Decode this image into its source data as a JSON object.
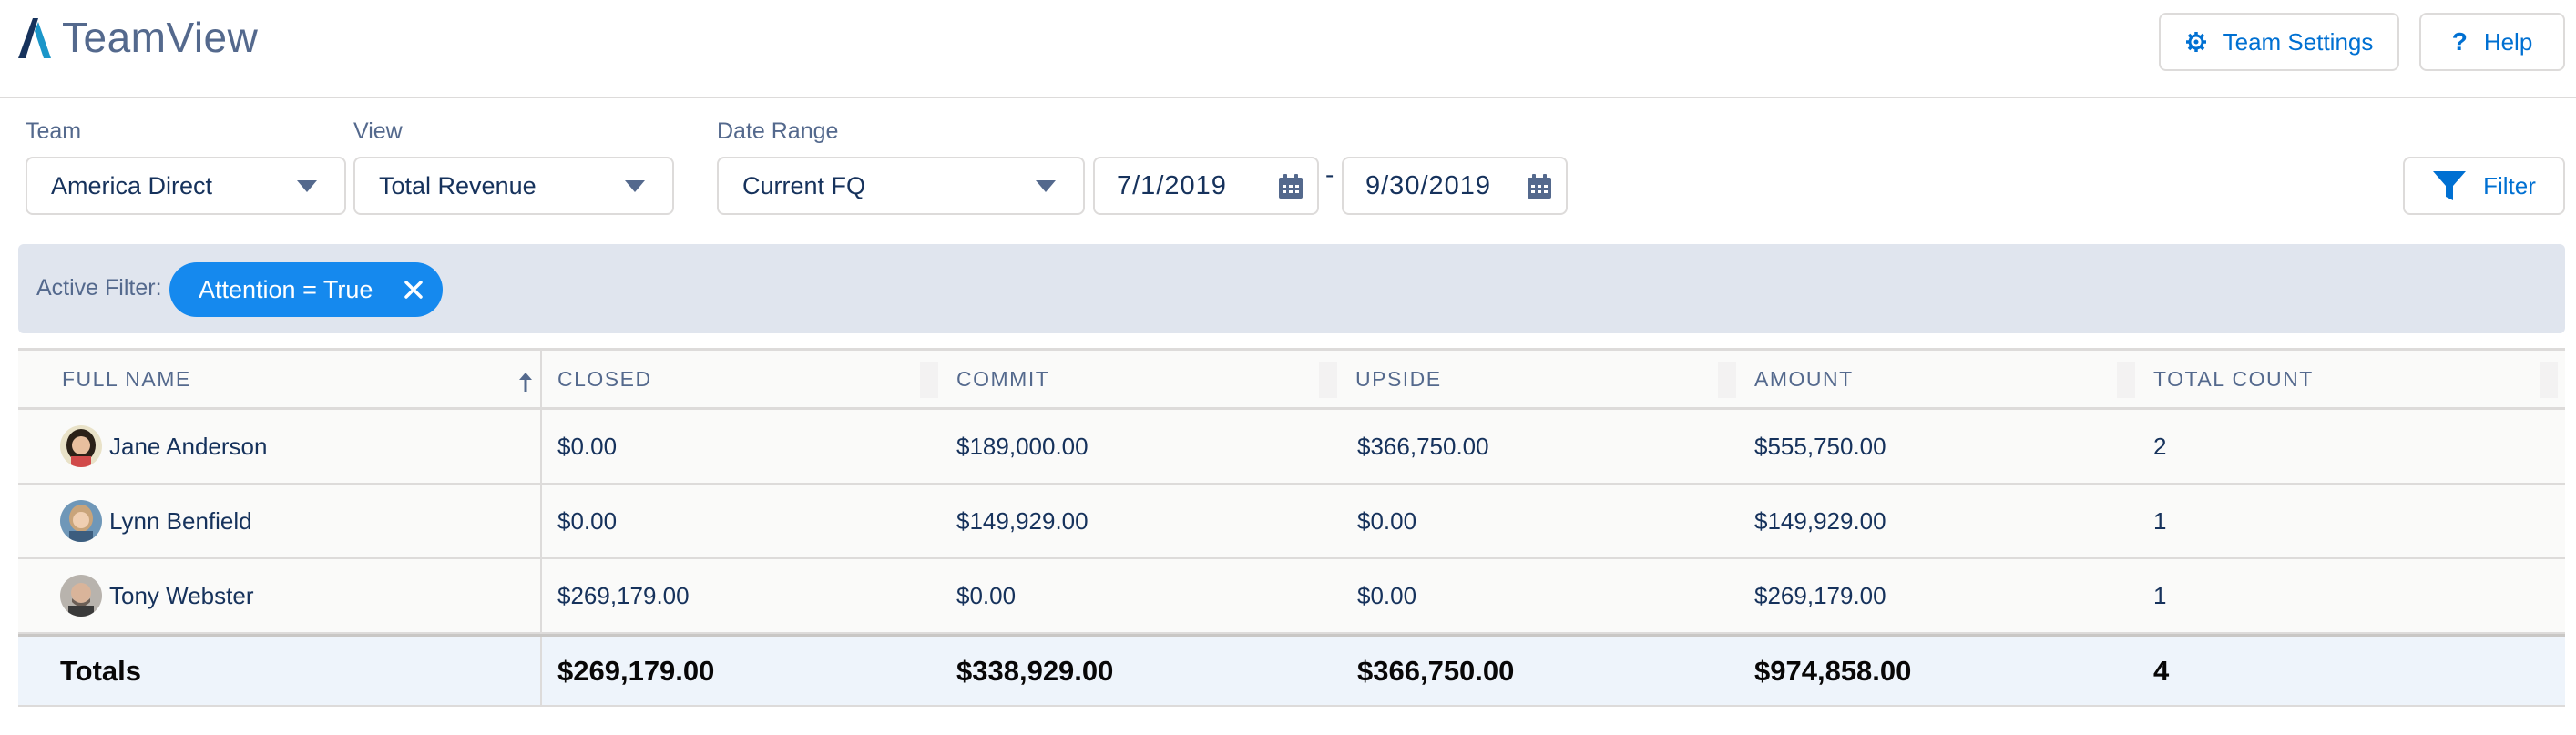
{
  "app": {
    "title": "TeamView"
  },
  "header": {
    "settings_label": "Team Settings",
    "help_label": "Help"
  },
  "filters": {
    "team": {
      "label": "Team",
      "value": "America Direct"
    },
    "view": {
      "label": "View",
      "value": "Total Revenue"
    },
    "date_range": {
      "label": "Date Range",
      "value": "Current FQ",
      "start": "7/1/2019",
      "end": "9/30/2019",
      "separator": "-"
    },
    "filter_button_label": "Filter"
  },
  "active_filter": {
    "label": "Active Filter:",
    "pill": "Attention = True"
  },
  "table": {
    "columns": [
      "FULL NAME",
      "CLOSED",
      "COMMIT",
      "UPSIDE",
      "AMOUNT",
      "TOTAL COUNT"
    ],
    "sorted_column": "FULL NAME",
    "sort_direction": "ascending",
    "rows": [
      {
        "name": "Jane Anderson",
        "closed": "$0.00",
        "commit": "$189,000.00",
        "upside": "$366,750.00",
        "amount": "$555,750.00",
        "count": "2"
      },
      {
        "name": "Lynn Benfield",
        "closed": "$0.00",
        "commit": "$149,929.00",
        "upside": "$0.00",
        "amount": "$149,929.00",
        "count": "1"
      },
      {
        "name": "Tony Webster",
        "closed": "$269,179.00",
        "commit": "$0.00",
        "upside": "$0.00",
        "amount": "$269,179.00",
        "count": "1"
      }
    ],
    "totals": {
      "label": "Totals",
      "closed": "$269,179.00",
      "commit": "$338,929.00",
      "upside": "$366,750.00",
      "amount": "$974,858.00",
      "count": "4"
    }
  },
  "colors": {
    "accent": "#0070d2",
    "pill": "#1589ee",
    "filter_bar": "#e0e5ee",
    "totals_row": "#eef4fb",
    "brand_logo": "#1b96c9"
  }
}
